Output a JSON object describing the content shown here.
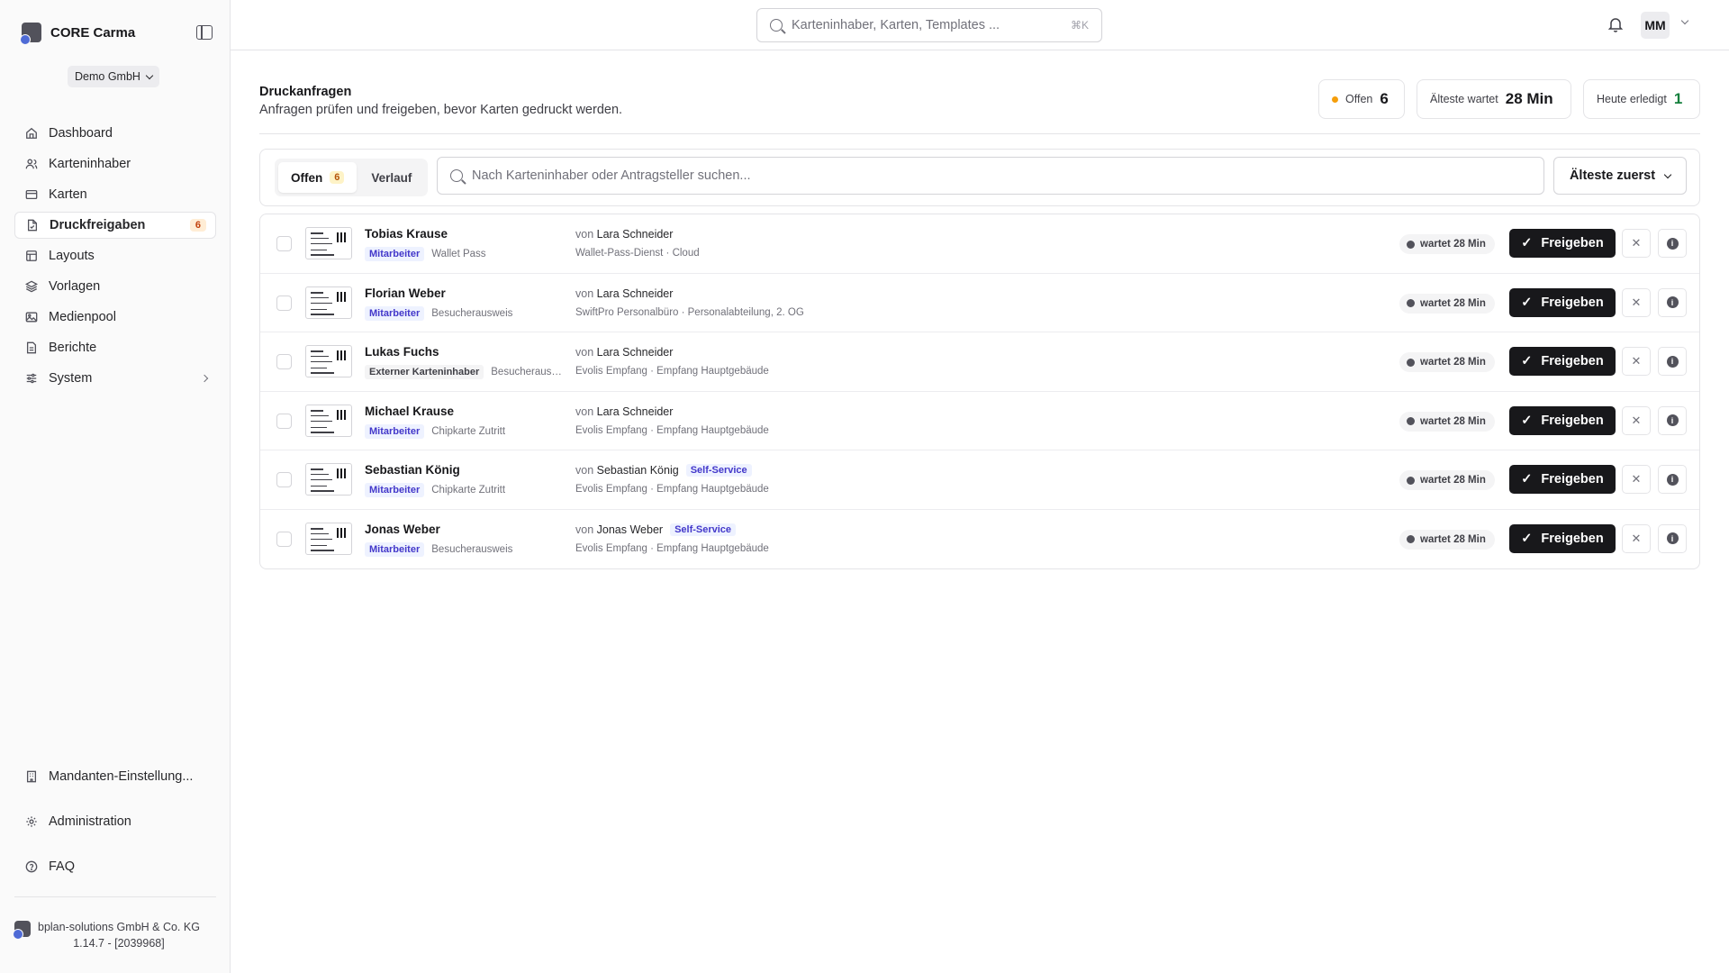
{
  "app": {
    "name": "CORE Carma",
    "tenant": "Demo GmbH"
  },
  "sidebar": {
    "items": [
      {
        "label": "Dashboard",
        "icon": "home-icon"
      },
      {
        "label": "Karteninhaber",
        "icon": "users-icon"
      },
      {
        "label": "Karten",
        "icon": "card-icon"
      },
      {
        "label": "Druckfreigaben",
        "icon": "file-check-icon",
        "badge": "6",
        "active": true
      },
      {
        "label": "Layouts",
        "icon": "layout-icon"
      },
      {
        "label": "Vorlagen",
        "icon": "layers-icon"
      },
      {
        "label": "Medienpool",
        "icon": "image-icon"
      },
      {
        "label": "Berichte",
        "icon": "report-icon"
      },
      {
        "label": "System",
        "icon": "sliders-icon"
      }
    ],
    "bottom": [
      {
        "label": "Mandanten-Einstellung...",
        "icon": "building-icon"
      },
      {
        "label": "Administration",
        "icon": "gear-icon"
      },
      {
        "label": "FAQ",
        "icon": "help-icon"
      }
    ],
    "footer": {
      "company": "bplan-solutions GmbH & Co. KG",
      "version": "1.14.7 - [2039968]"
    }
  },
  "topbar": {
    "search_placeholder": "Karteninhaber, Karten, Templates ...",
    "shortcut": "⌘K",
    "user_initials": "MM"
  },
  "page": {
    "title": "Druckanfragen",
    "subtitle": "Anfragen prüfen und freigeben, bevor Karten gedruckt werden."
  },
  "stats": {
    "open_label": "Offen",
    "open_value": "6",
    "oldest_label": "Älteste wartet",
    "oldest_value": "28 Min",
    "done_label": "Heute erledigt",
    "done_value": "1"
  },
  "filters": {
    "tab_open": "Offen",
    "tab_open_count": "6",
    "tab_history": "Verlauf",
    "search_placeholder": "Nach Karteninhaber oder Antragsteller suchen...",
    "sort_label": "Älteste zuerst"
  },
  "actions": {
    "approve": "Freigeben"
  },
  "colors": {
    "accent": "#18181b",
    "badge_bg": "#ffedd5",
    "role_bg": "#eef2ff",
    "open_dot": "#f59e0b",
    "done_value": "#15803d"
  },
  "rows": [
    {
      "name": "Tobias Krause",
      "role": "Mitarbeiter",
      "card_type": "Wallet Pass",
      "by_prefix": "von",
      "requester": "Lara Schneider",
      "self_service": "",
      "dept": "Wallet-Pass-Dienst · Cloud",
      "wait": "wartet 28 Min"
    },
    {
      "name": "Florian Weber",
      "role": "Mitarbeiter",
      "card_type": "Besucherausweis",
      "by_prefix": "von",
      "requester": "Lara Schneider",
      "self_service": "",
      "dept": "SwiftPro Personalbüro · Personalabteilung, 2. OG",
      "wait": "wartet 28 Min"
    },
    {
      "name": "Lukas Fuchs",
      "role": "Externer Karteninhaber",
      "card_type": "Besucherausw...",
      "by_prefix": "von",
      "requester": "Lara Schneider",
      "self_service": "",
      "dept": "Evolis Empfang · Empfang Hauptgebäude",
      "wait": "wartet 28 Min"
    },
    {
      "name": "Michael Krause",
      "role": "Mitarbeiter",
      "card_type": "Chipkarte Zutritt",
      "by_prefix": "von",
      "requester": "Lara Schneider",
      "self_service": "",
      "dept": "Evolis Empfang · Empfang Hauptgebäude",
      "wait": "wartet 28 Min"
    },
    {
      "name": "Sebastian König",
      "role": "Mitarbeiter",
      "card_type": "Chipkarte Zutritt",
      "by_prefix": "von",
      "requester": "Sebastian König",
      "self_service": "Self-Service",
      "dept": "Evolis Empfang · Empfang Hauptgebäude",
      "wait": "wartet 28 Min"
    },
    {
      "name": "Jonas Weber",
      "role": "Mitarbeiter",
      "card_type": "Besucherausweis",
      "by_prefix": "von",
      "requester": "Jonas Weber",
      "self_service": "Self-Service",
      "dept": "Evolis Empfang · Empfang Hauptgebäude",
      "wait": "wartet 28 Min"
    }
  ]
}
